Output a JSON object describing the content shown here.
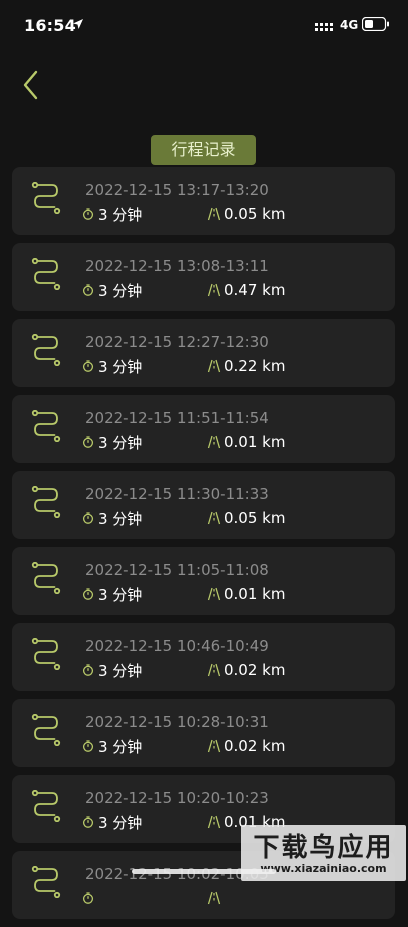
{
  "status_bar": {
    "time": "16:54",
    "network": "4G"
  },
  "page": {
    "title": "行程记录"
  },
  "colors": {
    "accent": "#b8c96a",
    "title_bg": "#6a7a38",
    "card_bg": "#232323",
    "background": "#141414"
  },
  "trips": [
    {
      "datetime": "2022-12-15  13:17-13:20",
      "duration": "3 分钟",
      "distance": "0.05 km"
    },
    {
      "datetime": "2022-12-15  13:08-13:11",
      "duration": "3 分钟",
      "distance": "0.47 km"
    },
    {
      "datetime": "2022-12-15  12:27-12:30",
      "duration": "3 分钟",
      "distance": "0.22 km"
    },
    {
      "datetime": "2022-12-15  11:51-11:54",
      "duration": "3 分钟",
      "distance": "0.01 km"
    },
    {
      "datetime": "2022-12-15  11:30-11:33",
      "duration": "3 分钟",
      "distance": "0.05 km"
    },
    {
      "datetime": "2022-12-15  11:05-11:08",
      "duration": "3 分钟",
      "distance": "0.01 km"
    },
    {
      "datetime": "2022-12-15  10:46-10:49",
      "duration": "3 分钟",
      "distance": "0.02 km"
    },
    {
      "datetime": "2022-12-15  10:28-10:31",
      "duration": "3 分钟",
      "distance": "0.02 km"
    },
    {
      "datetime": "2022-12-15  10:20-10:23",
      "duration": "3 分钟",
      "distance": "0.01 km"
    },
    {
      "datetime": "2022-12-15  10:02-10:05",
      "duration": "",
      "distance": ""
    }
  ],
  "watermark": {
    "title": "下载鸟应用",
    "url": "www.xiazainiao.com"
  }
}
